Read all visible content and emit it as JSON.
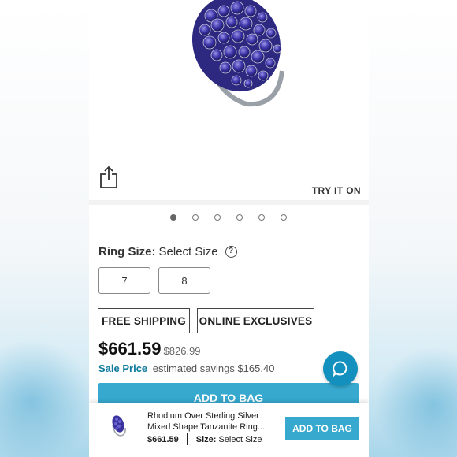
{
  "product": {
    "try_on_label": "TRY IT ON",
    "carousel": {
      "total": 6,
      "active_index": 0
    }
  },
  "ring_size": {
    "label": "Ring Size:",
    "prompt": "Select Size",
    "options": [
      "7",
      "8"
    ]
  },
  "tags": [
    "FREE SHIPPING",
    "ONLINE EXCLUSIVES"
  ],
  "pricing": {
    "price": "$661.59",
    "original_price": "$826.99",
    "sale_label": "Sale Price",
    "savings": "estimated savings $165.40"
  },
  "main_add_to_bag": "ADD TO BAG",
  "sticky": {
    "title": "Rhodium Over Sterling Silver Mixed Shape Tanzanite Ring...",
    "price": "$661.59",
    "size_label": "Size:",
    "size_value": "Select Size",
    "add_to_bag": "ADD TO BAG"
  },
  "icons": [
    "share-icon",
    "help-icon",
    "chat-icon"
  ],
  "colors": {
    "accent": "#37a9cf",
    "sale": "#0e7a9c",
    "chat": "#1390be"
  }
}
